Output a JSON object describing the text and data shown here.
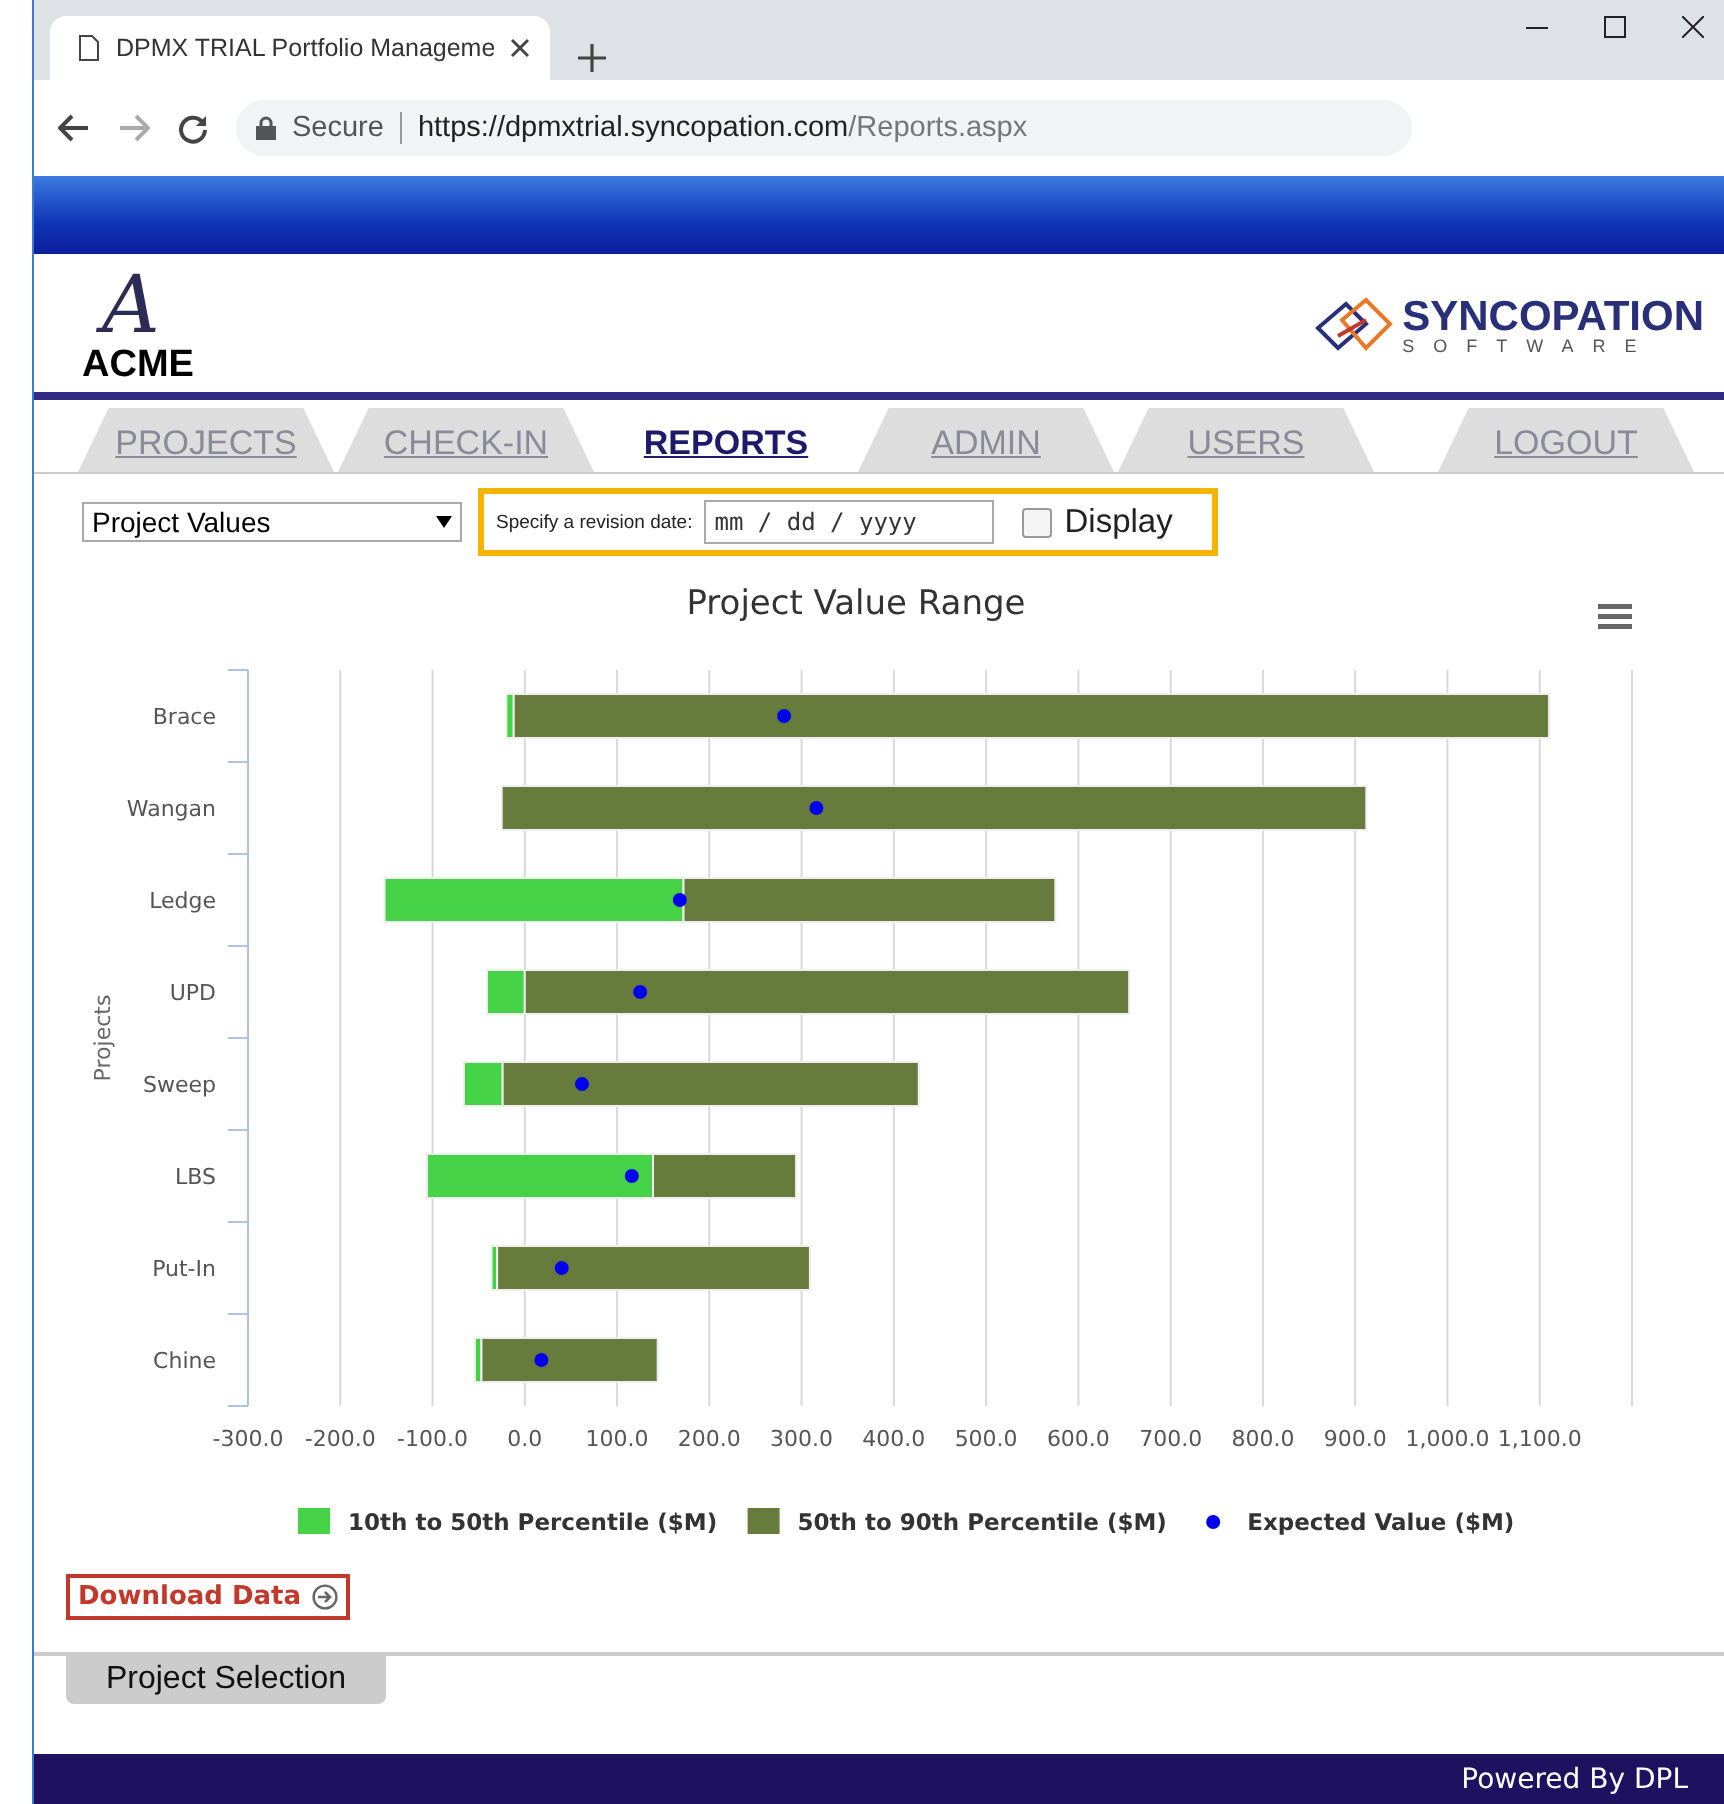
{
  "browser": {
    "tab_title": "DPMX TRIAL Portfolio Manageme",
    "security": "Secure",
    "url_host": "https://dpmxtrial.syncopation.com",
    "url_path": "/Reports.aspx"
  },
  "header": {
    "left_logo": {
      "mark": "A",
      "name": "ACME"
    },
    "right_logo": {
      "name": "SYNCOPATION",
      "tagline": "SOFTWARE"
    }
  },
  "tabs": [
    {
      "label": "PROJECTS",
      "selected": false
    },
    {
      "label": "CHECK-IN",
      "selected": false
    },
    {
      "label": "REPORTS",
      "selected": true
    },
    {
      "label": "ADMIN",
      "selected": false
    },
    {
      "label": "USERS",
      "selected": false
    },
    {
      "label": "LOGOUT",
      "selected": false
    }
  ],
  "controls": {
    "report_select": "Project Values",
    "revision_label": "Specify a revision date:",
    "date_placeholder": "mm / dd / yyyy",
    "display": {
      "label": "Display",
      "checked": false
    }
  },
  "chart": {
    "chart_data": {
      "type": "bar",
      "orientation": "horizontal",
      "title": "Project Value Range",
      "ylabel": "Projects",
      "categories": [
        "Brace",
        "Wangan",
        "Ledge",
        "UPD",
        "Sweep",
        "LBS",
        "Put-In",
        "Chine"
      ],
      "xlim": [
        -300,
        1200
      ],
      "xticks": [
        {
          "value": -300,
          "label": "-300.0"
        },
        {
          "value": -200,
          "label": "-200.0"
        },
        {
          "value": -100,
          "label": "-100.0"
        },
        {
          "value": 0,
          "label": "0.0"
        },
        {
          "value": 100,
          "label": "100.0"
        },
        {
          "value": 200,
          "label": "200.0"
        },
        {
          "value": 300,
          "label": "300.0"
        },
        {
          "value": 400,
          "label": "400.0"
        },
        {
          "value": 500,
          "label": "500.0"
        },
        {
          "value": 600,
          "label": "600.0"
        },
        {
          "value": 700,
          "label": "700.0"
        },
        {
          "value": 800,
          "label": "800.0"
        },
        {
          "value": 900,
          "label": "900.0"
        },
        {
          "value": 1000,
          "label": "1,000.0"
        },
        {
          "value": 1100,
          "label": "1,100.0"
        }
      ],
      "series": [
        {
          "name": "10th to 50th Percentile ($M)",
          "color": "#46d246",
          "base": [
            -20,
            null,
            -152,
            -41,
            -66,
            -106,
            -36,
            -54
          ],
          "values": [
            8,
            null,
            324,
            41,
            42,
            245,
            6,
            7
          ]
        },
        {
          "name": "50th to 90th Percentile ($M)",
          "color": "#677c3c",
          "base": [
            -12,
            -25,
            172,
            0,
            -24,
            139,
            -30,
            -47
          ],
          "values": [
            1122,
            937,
            403,
            655,
            451,
            155,
            339,
            191
          ]
        },
        {
          "name": "Expected Value ($M)",
          "color": "#0000ee",
          "type": "scatter",
          "values": [
            281,
            316,
            168,
            125,
            62,
            116,
            40,
            18
          ]
        }
      ],
      "grid": true,
      "legend": "bottom"
    }
  },
  "download": "Download Data",
  "section_tab": "Project Selection",
  "footer": "Powered By DPL"
}
